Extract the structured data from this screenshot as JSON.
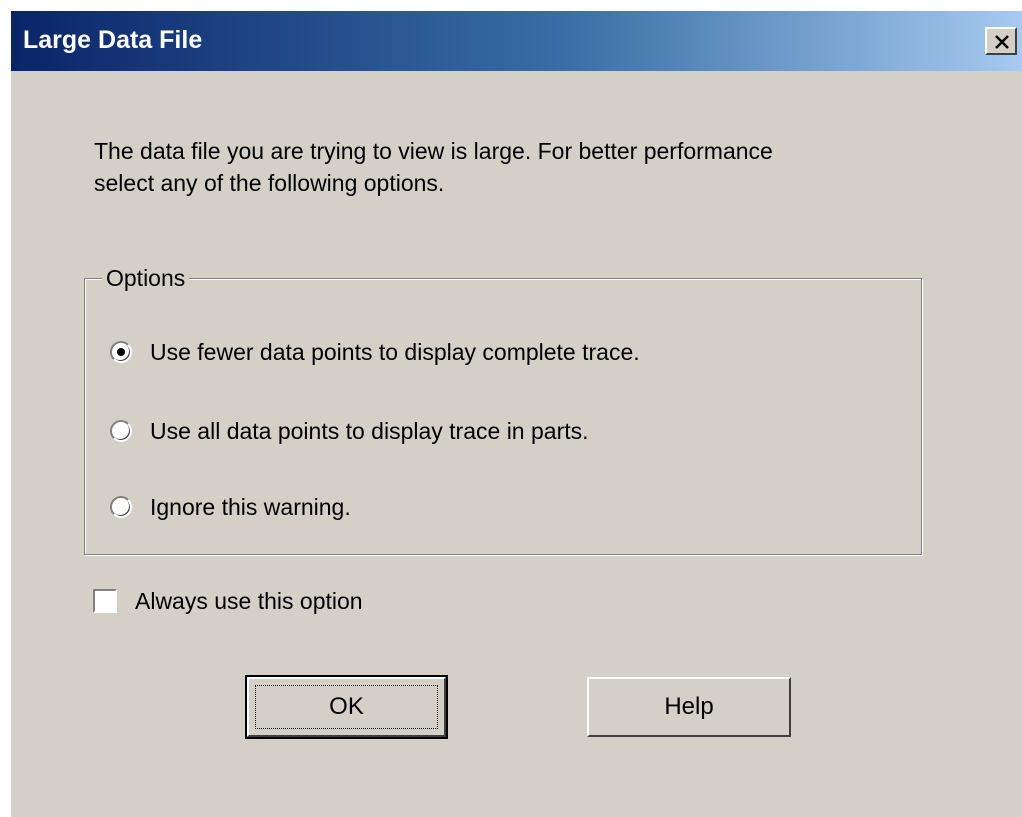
{
  "window": {
    "title": "Large Data File",
    "close_icon": "close-icon"
  },
  "message": {
    "line1": "The data file you are trying to view is large. For better performance",
    "line2": "select any of the following options."
  },
  "options": {
    "group_label": "Options",
    "items": [
      {
        "label": "Use fewer data points to display complete trace.",
        "selected": true
      },
      {
        "label": "Use all data points to display trace in parts.",
        "selected": false
      },
      {
        "label": "Ignore this warning.",
        "selected": false
      }
    ]
  },
  "always_use": {
    "label": "Always use this option",
    "checked": false
  },
  "buttons": {
    "ok_label": "OK",
    "help_label": "Help"
  },
  "colors": {
    "dialog_face": "#d4d0c8",
    "title_start": "#0a246a",
    "title_end": "#a6caf0"
  }
}
